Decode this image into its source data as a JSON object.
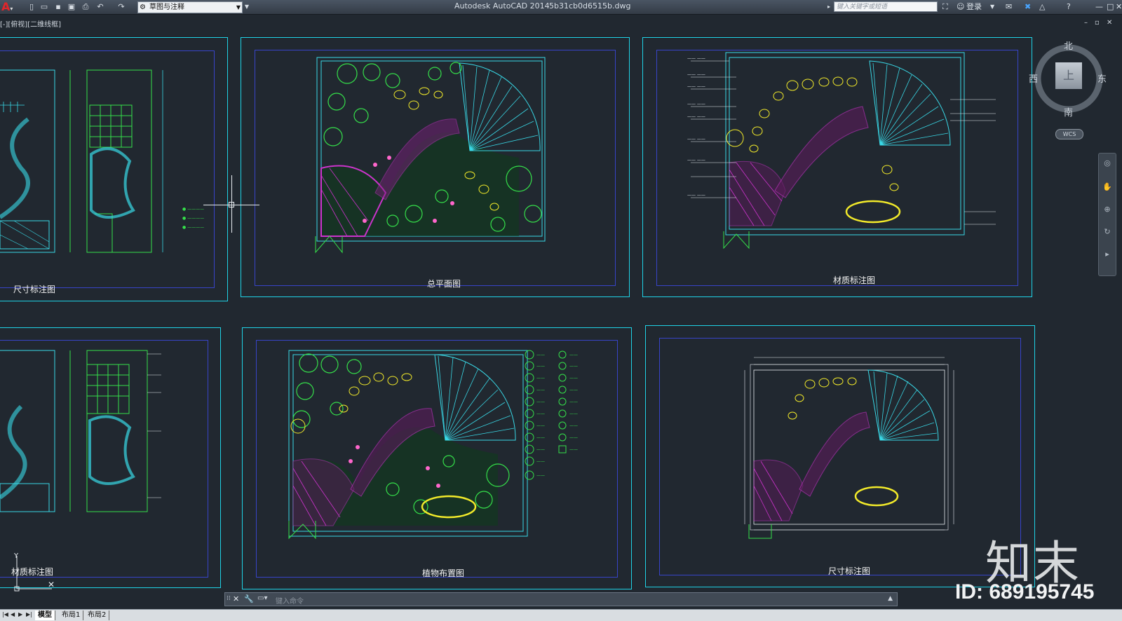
{
  "titlebar": {
    "app_title": "Autodesk AutoCAD 2014",
    "file_name": "5b31cb0d6515b.dwg",
    "workspace": "草图与注释",
    "search_placeholder": "键入关键字或短语",
    "login": "登录"
  },
  "viewport": {
    "label": "[-][俯视][二维线框]"
  },
  "sheets": {
    "s1": {
      "title": "尺寸标注图"
    },
    "s2": {
      "title": "总平面图"
    },
    "s3": {
      "title": "材质标注图"
    },
    "s4": {
      "title": "材质标注图"
    },
    "s5": {
      "title": "植物布置图"
    },
    "s6": {
      "title": "尺寸标注图"
    }
  },
  "viewcube": {
    "north": "北",
    "south": "南",
    "east": "东",
    "west": "西",
    "top": "上",
    "wcs": "WCS"
  },
  "command": {
    "placeholder": "键入命令"
  },
  "layout_tabs": [
    "模型",
    "布局1",
    "布局2"
  ],
  "watermark": {
    "logo": "知末",
    "id": "ID: 689195745"
  },
  "colors": {
    "background": "#212830",
    "frame": "#1fd3e6",
    "inner_frame": "#3844c8",
    "green": "#35e04a",
    "magenta": "#cc33cc",
    "yellow": "#f2ea2a",
    "cyan": "#39d8e6"
  }
}
